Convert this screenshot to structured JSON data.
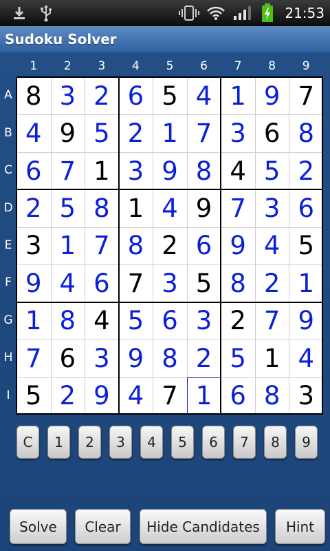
{
  "status_bar": {
    "time": "21:53",
    "icons": [
      "download-icon",
      "usb-icon",
      "vibrate-icon",
      "wifi-icon",
      "signal-icon",
      "battery-charging-icon"
    ]
  },
  "app": {
    "title": "Sudoku Solver"
  },
  "colors": {
    "given": "#000000",
    "solved": "#0b1fd8",
    "background": "#1d497e"
  },
  "grid": {
    "col_labels": [
      "1",
      "2",
      "3",
      "4",
      "5",
      "6",
      "7",
      "8",
      "9"
    ],
    "row_labels": [
      "A",
      "B",
      "C",
      "D",
      "E",
      "F",
      "G",
      "H",
      "I"
    ],
    "values": [
      [
        "8",
        "3",
        "2",
        "6",
        "5",
        "4",
        "1",
        "9",
        "7"
      ],
      [
        "4",
        "9",
        "5",
        "2",
        "1",
        "7",
        "3",
        "6",
        "8"
      ],
      [
        "6",
        "7",
        "1",
        "3",
        "9",
        "8",
        "4",
        "5",
        "2"
      ],
      [
        "2",
        "5",
        "8",
        "1",
        "4",
        "9",
        "7",
        "3",
        "6"
      ],
      [
        "3",
        "1",
        "7",
        "8",
        "2",
        "6",
        "9",
        "4",
        "5"
      ],
      [
        "9",
        "4",
        "6",
        "7",
        "3",
        "5",
        "8",
        "2",
        "1"
      ],
      [
        "1",
        "8",
        "4",
        "5",
        "6",
        "3",
        "2",
        "7",
        "9"
      ],
      [
        "7",
        "6",
        "3",
        "9",
        "8",
        "2",
        "5",
        "1",
        "4"
      ],
      [
        "5",
        "2",
        "9",
        "4",
        "7",
        "1",
        "6",
        "8",
        "3"
      ]
    ],
    "given": [
      [
        1,
        0,
        0,
        0,
        1,
        0,
        0,
        0,
        1
      ],
      [
        0,
        1,
        0,
        0,
        0,
        0,
        0,
        1,
        0
      ],
      [
        0,
        0,
        1,
        0,
        0,
        0,
        1,
        0,
        0
      ],
      [
        0,
        0,
        0,
        1,
        0,
        1,
        0,
        0,
        0
      ],
      [
        1,
        0,
        0,
        0,
        1,
        0,
        0,
        0,
        1
      ],
      [
        0,
        0,
        0,
        1,
        0,
        1,
        0,
        0,
        0
      ],
      [
        0,
        0,
        1,
        0,
        0,
        0,
        1,
        0,
        0
      ],
      [
        0,
        1,
        0,
        0,
        0,
        0,
        0,
        1,
        0
      ],
      [
        1,
        0,
        0,
        0,
        1,
        0,
        0,
        0,
        1
      ]
    ],
    "selected_cell": "I6"
  },
  "keypad": [
    "C",
    "1",
    "2",
    "3",
    "4",
    "5",
    "6",
    "7",
    "8",
    "9"
  ],
  "actions": {
    "solve": "Solve",
    "clear": "Clear",
    "hide_candidates": "Hide Candidates",
    "hint": "Hint"
  }
}
